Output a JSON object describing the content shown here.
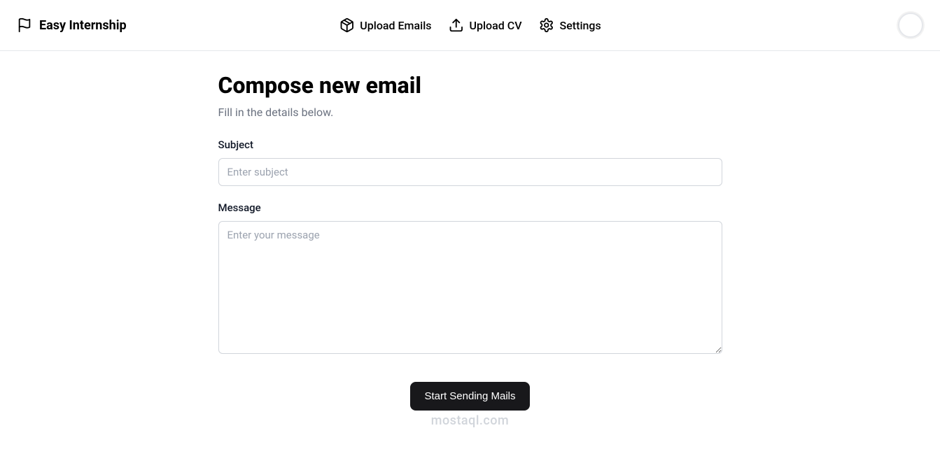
{
  "header": {
    "brand": "Easy Internship",
    "nav": {
      "upload_emails": "Upload Emails",
      "upload_cv": "Upload CV",
      "settings": "Settings"
    }
  },
  "main": {
    "title": "Compose new email",
    "subtitle": "Fill in the details below.",
    "subject_label": "Subject",
    "subject_placeholder": "Enter subject",
    "message_label": "Message",
    "message_placeholder": "Enter your message",
    "submit_button": "Start Sending Mails"
  },
  "watermark": "mostaql.com"
}
